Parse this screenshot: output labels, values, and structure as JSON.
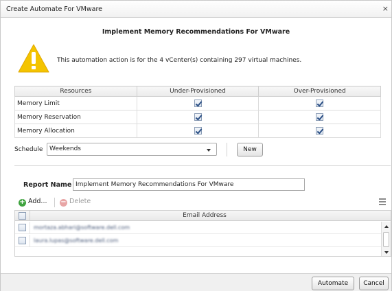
{
  "dialog": {
    "title": "Create Automate For VMware",
    "close_glyph": "×",
    "heading": "Implement Memory Recommendations For VMware",
    "info_text": "This automation action is for the 4 vCenter(s) containing 297 virtual machines.",
    "warning_icon": "warning-triangle-icon"
  },
  "resources_table": {
    "headers": [
      "Resources",
      "Under-Provisioned",
      "Over-Provisioned"
    ],
    "rows": [
      {
        "name": "Memory Limit",
        "under": true,
        "over": true
      },
      {
        "name": "Memory Reservation",
        "under": true,
        "over": true
      },
      {
        "name": "Memory Allocation",
        "under": true,
        "over": true
      }
    ]
  },
  "schedule": {
    "label": "Schedule",
    "value": "Weekends",
    "new_button": "New"
  },
  "report": {
    "label": "Report Name",
    "value": "Implement Memory Recommendations For VMware"
  },
  "email_toolbar": {
    "add_label": "Add...",
    "delete_label": "Delete"
  },
  "email_grid": {
    "column": "Email Address",
    "rows": [
      {
        "email": "mortaza.abhari@software.dell.com",
        "checked": false
      },
      {
        "email": "laura.lupas@software.dell.com",
        "checked": false
      }
    ]
  },
  "footer": {
    "automate_button": "Automate",
    "cancel_button": "Cancel"
  },
  "colors": {
    "warning": "#f4c400",
    "add_icon": "#3fa33f",
    "delete_icon": "#e8a5a5"
  }
}
